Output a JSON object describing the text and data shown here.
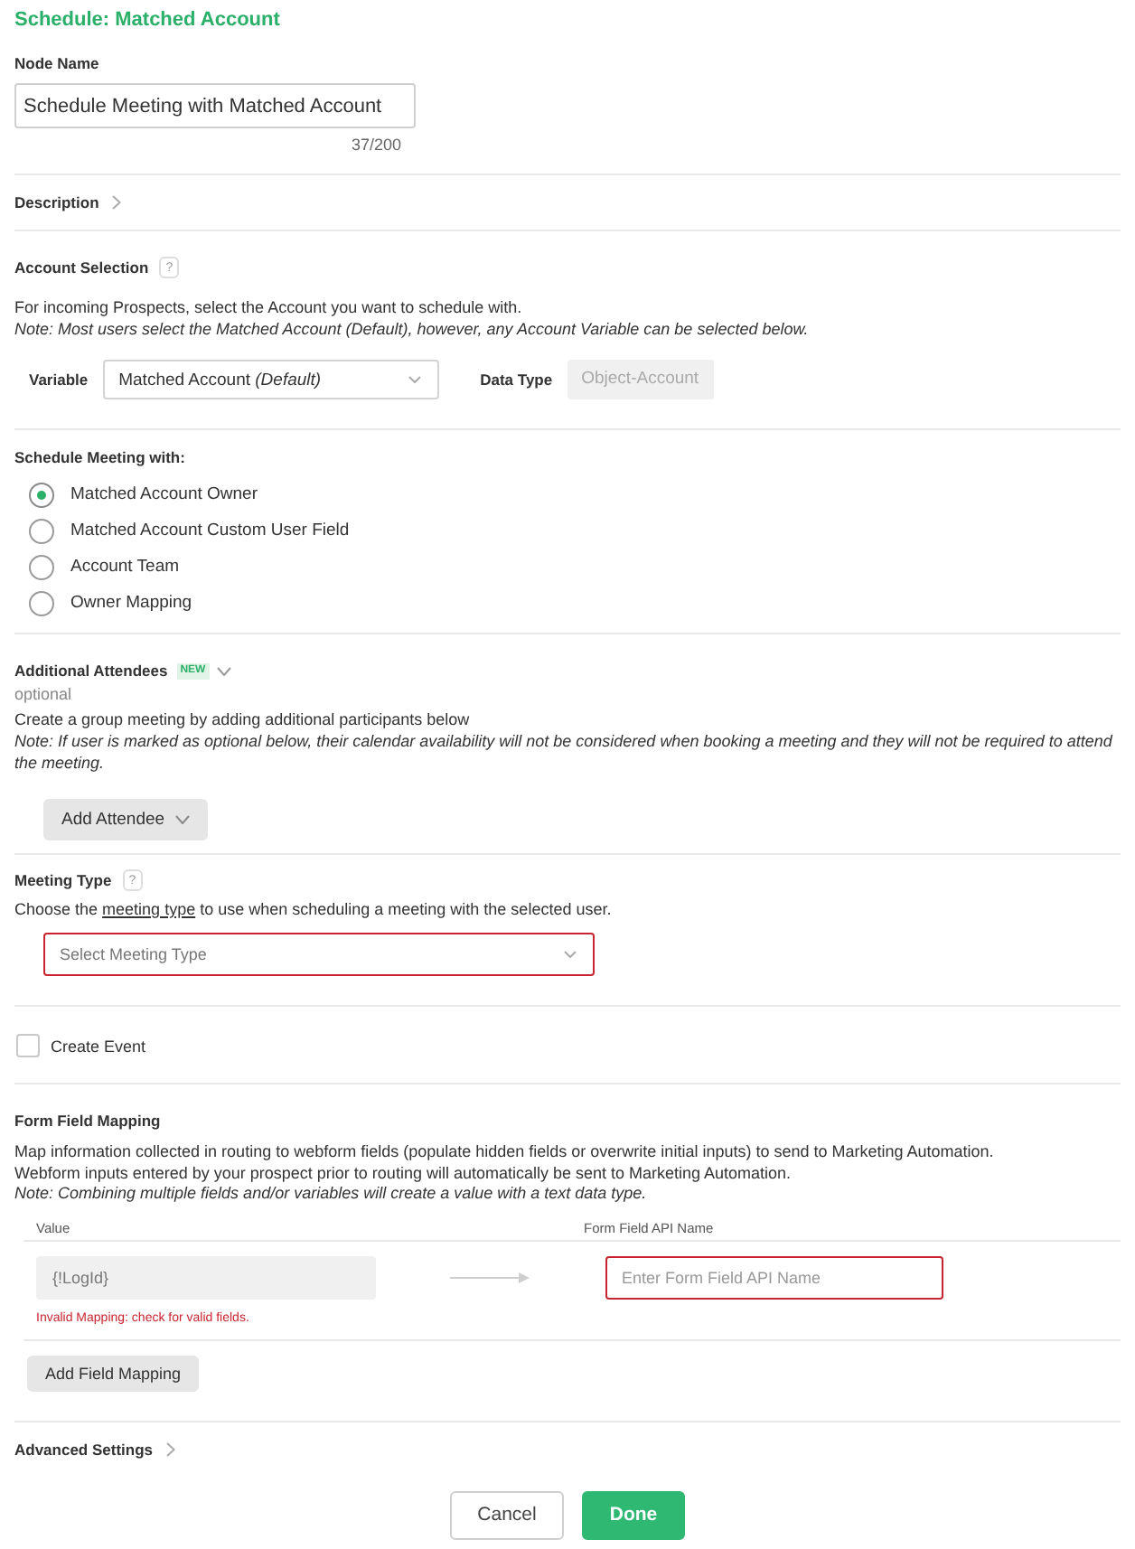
{
  "panel": {
    "title": "Schedule: Matched Account"
  },
  "node_name": {
    "label": "Node Name",
    "value": "Schedule Meeting with Matched Account",
    "counter": "37/200"
  },
  "description": {
    "label": "Description",
    "expanded": false
  },
  "account_selection": {
    "label": "Account Selection",
    "help": "?",
    "text": "For incoming Prospects, select the Account you want to schedule with.",
    "note": "Note: Most users select the Matched Account (Default), however, any Account Variable can be selected below.",
    "variable": {
      "label": "Variable",
      "value": "Matched Account *(Default)*"
    },
    "data_type": {
      "label": "Data Type",
      "value": "Object-Account",
      "disabled": true
    }
  },
  "schedule_with": {
    "label": "Schedule Meeting with:",
    "options": [
      {
        "label": "Matched Account Owner",
        "selected": true
      },
      {
        "label": "Matched Account Custom User Field",
        "selected": false
      },
      {
        "label": "Account Team",
        "selected": false
      },
      {
        "label": "Owner Mapping",
        "selected": false
      }
    ]
  },
  "additional_attendees": {
    "label": "Additional Attendees",
    "badge": "NEW",
    "sublabel": "optional",
    "text": "Create a group meeting by adding additional participants below",
    "note": "Note: If user is marked as optional below, their calendar availability will not be considered when booking a meeting and they will not be required to attend the meeting.",
    "button": "Add Attendee"
  },
  "meeting_type": {
    "label": "Meeting Type",
    "help": "?",
    "text_before": "Choose the ",
    "link": "meeting type",
    "text_after": " to use when scheduling a meeting with the selected user.",
    "select": {
      "placeholder": "Select Meeting Type",
      "invalid": true
    }
  },
  "create_event": {
    "label": "Create Event",
    "checked": false
  },
  "form_field_mapping": {
    "label": "Form Field Mapping",
    "lines": [
      "Map information collected in routing to webform fields (populate hidden fields or overwrite initial inputs) to send to Marketing Automation.",
      "Webform inputs entered by your prospect prior to routing will automatically be sent to Marketing Automation."
    ],
    "note": "Note: Combining multiple fields and/or variables will create a value with a text data type.",
    "columns": [
      "Value",
      "Form Field API Name"
    ],
    "rows": [
      {
        "value": "{!LogId}",
        "api_name": {
          "placeholder": "Enter Form Field API Name",
          "invalid": true
        },
        "error": "Invalid Mapping: check for valid fields."
      }
    ],
    "button": "Add Field Mapping"
  },
  "advanced_settings": {
    "label": "Advanced Settings",
    "expanded": false
  },
  "footer": {
    "buttons": [
      {
        "label": "Cancel",
        "kind": "secondary"
      },
      {
        "label": "Done",
        "kind": "primary"
      }
    ]
  }
}
